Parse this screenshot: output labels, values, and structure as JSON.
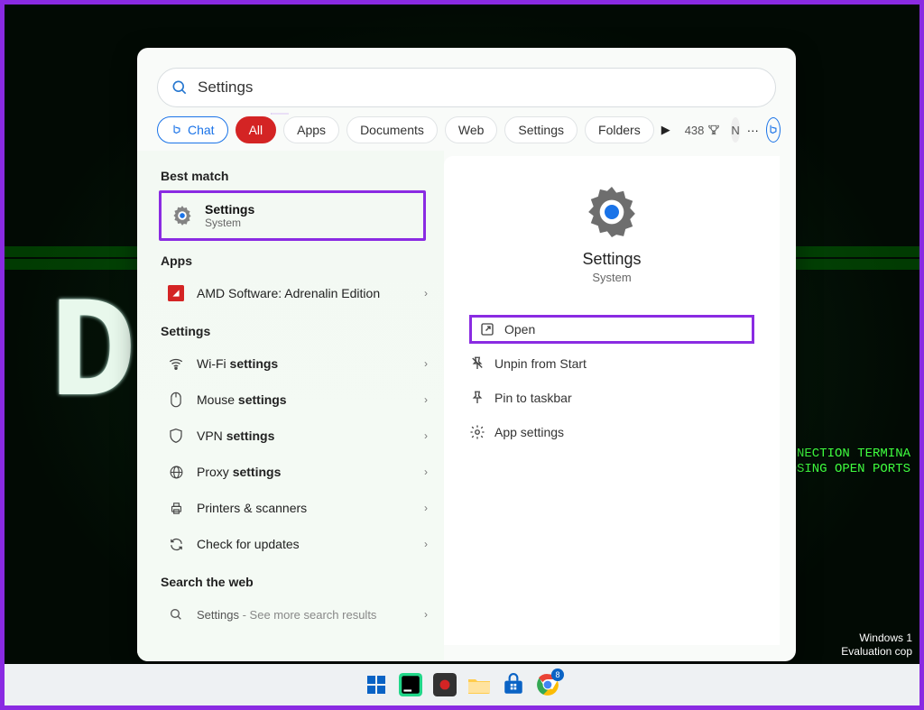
{
  "desktop": {
    "big_letters": "D            D",
    "green_line1": "CONNECTION TERMINA",
    "green_line2": "CLOSING OPEN PORTS",
    "corner_line1": "Windows 1",
    "corner_line2": "Evaluation cop"
  },
  "search": {
    "query": "Settings",
    "filters": {
      "chat": "Chat",
      "all": "All",
      "apps": "Apps",
      "documents": "Documents",
      "web": "Web",
      "settings": "Settings",
      "folders": "Folders"
    },
    "points": "438",
    "avatar_initial": "N"
  },
  "results": {
    "best_match_label": "Best match",
    "best_match": {
      "title": "Settings",
      "subtitle": "System"
    },
    "apps_label": "Apps",
    "apps": [
      {
        "label": "AMD Software: Adrenalin Edition"
      }
    ],
    "settings_label": "Settings",
    "settings": [
      {
        "prefix": "Wi-Fi ",
        "bold": "settings"
      },
      {
        "prefix": "Mouse ",
        "bold": "settings"
      },
      {
        "prefix": "VPN ",
        "bold": "settings"
      },
      {
        "prefix": "Proxy ",
        "bold": "settings"
      },
      {
        "prefix": "Printers & scanners",
        "bold": ""
      },
      {
        "prefix": "Check for updates",
        "bold": ""
      }
    ],
    "web_label": "Search the web",
    "web": {
      "term": "Settings",
      "hint": " - See more search results"
    }
  },
  "preview": {
    "title": "Settings",
    "subtitle": "System",
    "actions": {
      "open": "Open",
      "unpin": "Unpin from Start",
      "pin_taskbar": "Pin to taskbar",
      "app_settings": "App settings"
    }
  },
  "taskbar": {
    "badge": "8"
  }
}
